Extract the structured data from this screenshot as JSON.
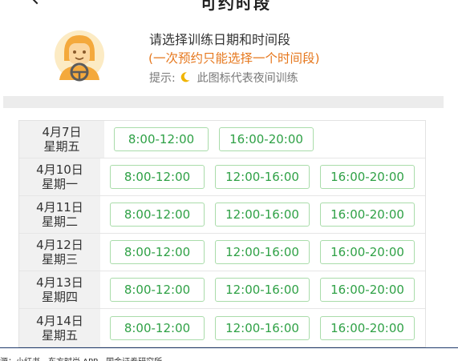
{
  "header": {
    "title": "可约时段"
  },
  "info": {
    "line1": "请选择训练日期和时间段",
    "line2": "(一次预约只能选择一个时间段)",
    "hint_label": "提示:",
    "hint_text": "此图标代表夜间训练"
  },
  "schedule": [
    {
      "date": "4月7日",
      "weekday": "星期五",
      "slots": [
        "8:00-12:00",
        "16:00-20:00"
      ]
    },
    {
      "date": "4月10日",
      "weekday": "星期一",
      "slots": [
        "8:00-12:00",
        "12:00-16:00",
        "16:00-20:00"
      ]
    },
    {
      "date": "4月11日",
      "weekday": "星期二",
      "slots": [
        "8:00-12:00",
        "12:00-16:00",
        "16:00-20:00"
      ]
    },
    {
      "date": "4月12日",
      "weekday": "星期三",
      "slots": [
        "8:00-12:00",
        "12:00-16:00",
        "16:00-20:00"
      ]
    },
    {
      "date": "4月13日",
      "weekday": "星期四",
      "slots": [
        "8:00-12:00",
        "12:00-16:00",
        "16:00-20:00"
      ]
    },
    {
      "date": "4月14日",
      "weekday": "星期五",
      "slots": [
        "8:00-12:00",
        "12:00-16:00",
        "16:00-20:00"
      ]
    }
  ],
  "source": "源：小红书、东方时尚 APP、国金证券研究所",
  "colors": {
    "slot_text": "#2fa146",
    "slot_border": "#a9dcaa",
    "warning": "#e6781e",
    "moon": "#f0b400"
  }
}
